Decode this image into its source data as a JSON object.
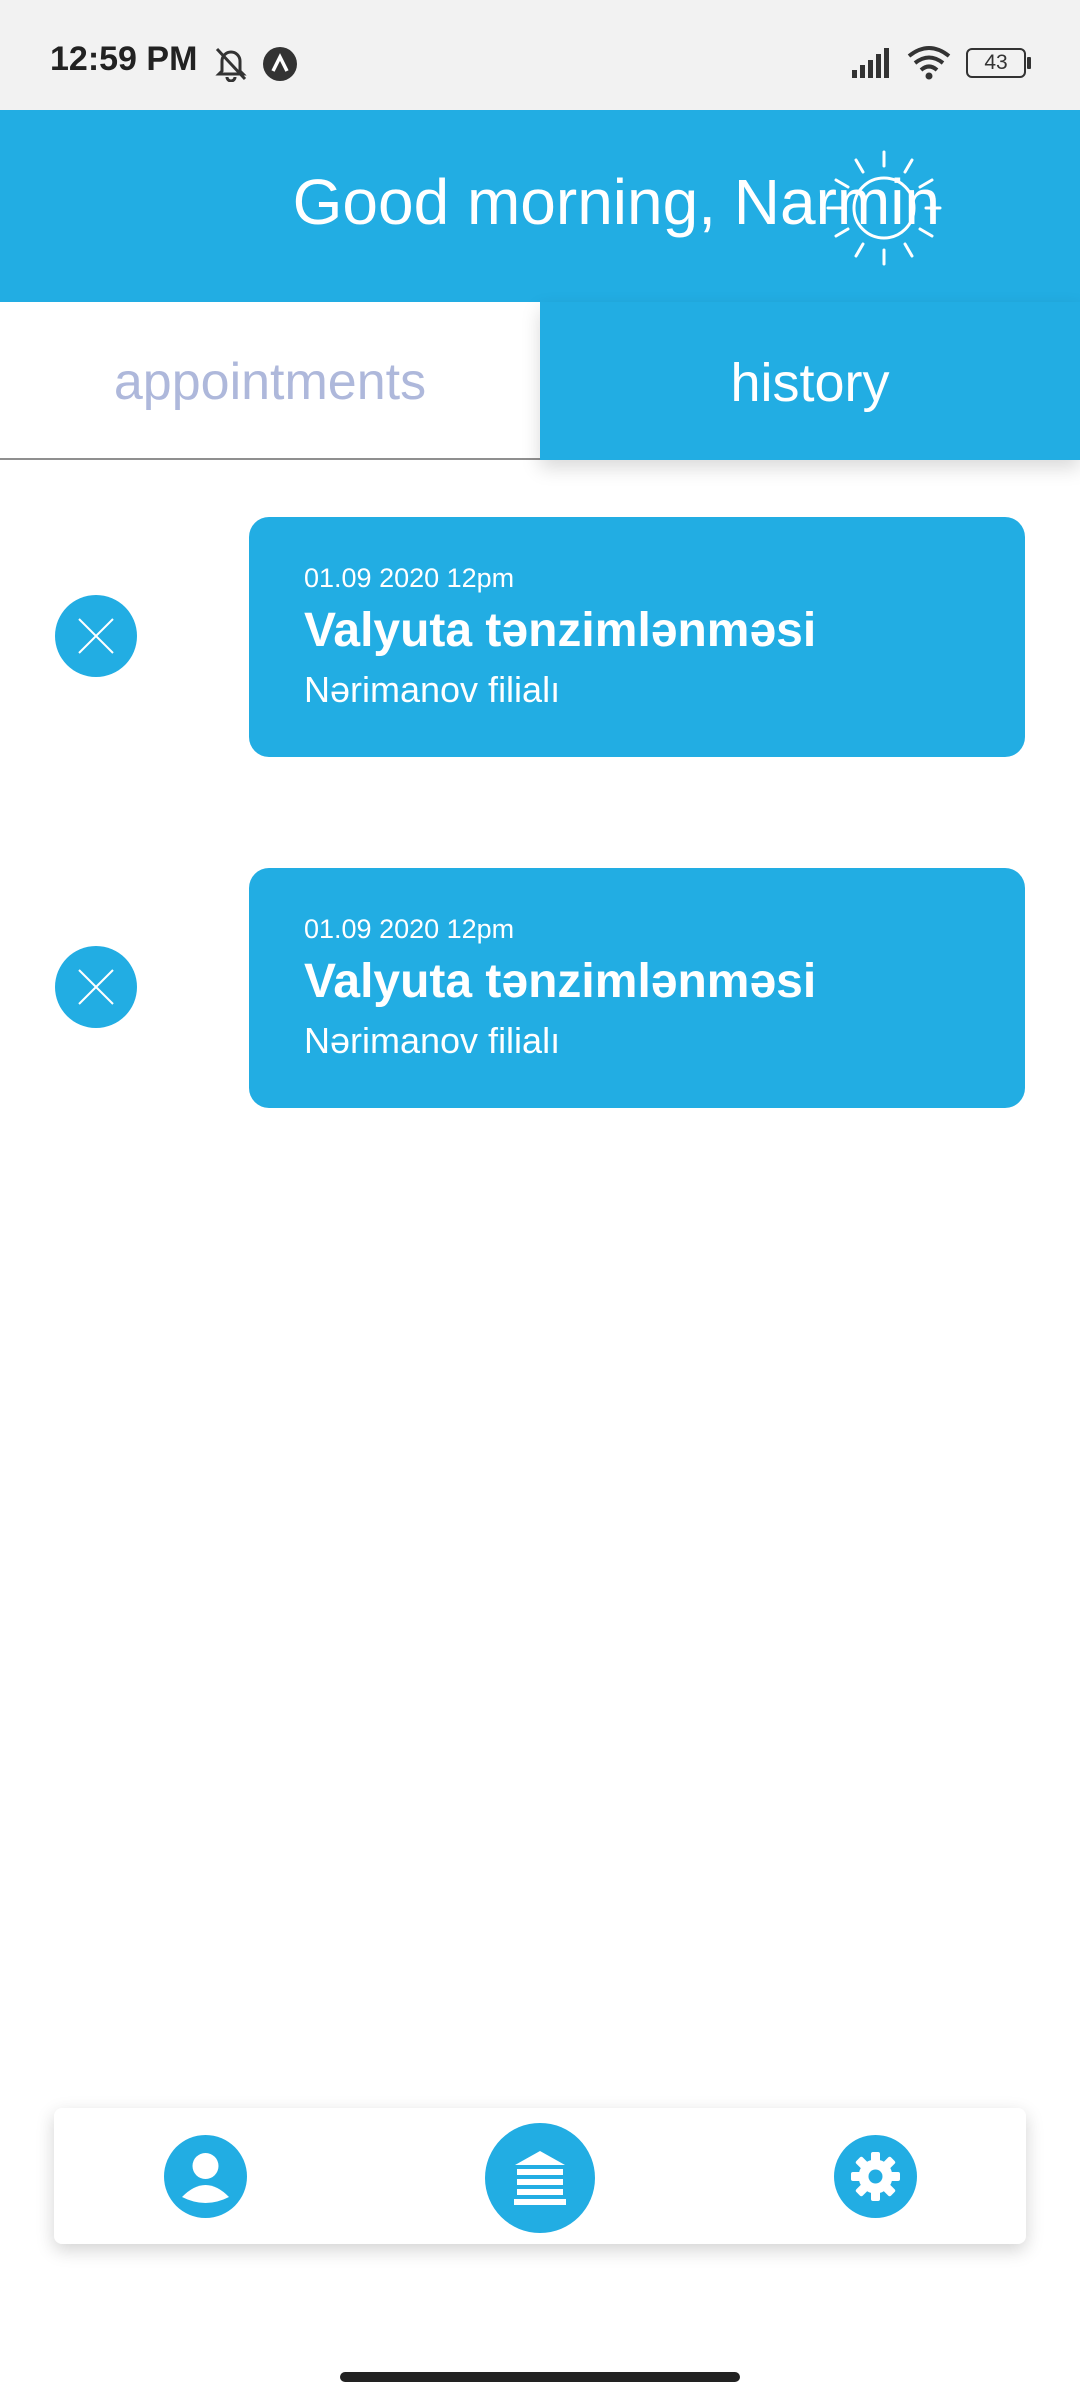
{
  "status_bar": {
    "time": "12:59 PM",
    "battery": "43",
    "icons": [
      "bell-off-icon",
      "app-notification-icon",
      "signal-icon",
      "wifi-icon",
      "battery-icon"
    ]
  },
  "header": {
    "greeting": "Good morning, Narmin",
    "icon": "sun-icon"
  },
  "tabs": [
    {
      "label": "appointments",
      "active": false
    },
    {
      "label": "history",
      "active": true
    }
  ],
  "appointments": [
    {
      "date": "01.09 2020 12pm",
      "title": "Valyuta tənzimlənməsi",
      "branch": "Nərimanov filialı"
    },
    {
      "date": "01.09 2020 12pm",
      "title": "Valyuta tənzimlənməsi",
      "branch": "Nərimanov filialı"
    }
  ],
  "bottom_nav": {
    "items": [
      "profile-icon",
      "bank-icon",
      "settings-icon"
    ]
  },
  "colors": {
    "accent": "#22ade3",
    "inactive_tab_text": "#aeb8db",
    "background": "#ffffff"
  }
}
